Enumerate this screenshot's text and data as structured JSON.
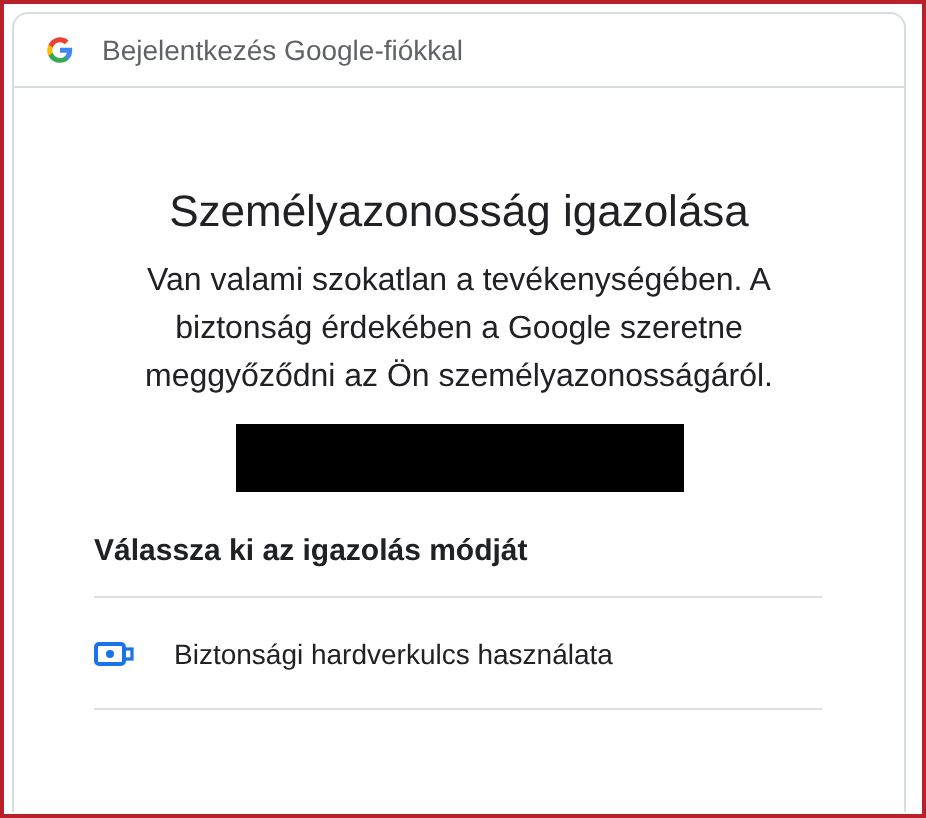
{
  "header": {
    "title": "Bejelentkezés Google-fiókkal"
  },
  "heading": "Személyazonosság igazolása",
  "description": "Van valami szokatlan a tevékenységében. A biztonság érdekében a Google szeretne meggyőződni az Ön személyazonosságáról.",
  "methods": {
    "title": "Válassza ki az igazolás módját",
    "options": [
      {
        "label": "Biztonsági hardverkulcs használata"
      }
    ]
  }
}
